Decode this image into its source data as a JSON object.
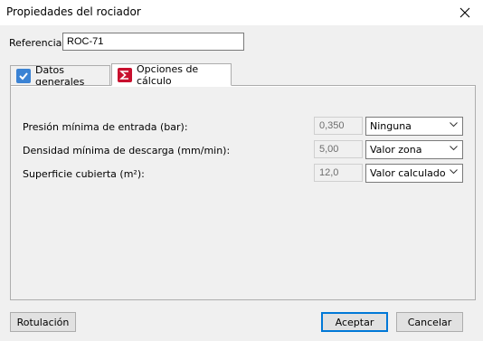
{
  "window": {
    "title": "Propiedades del rociador"
  },
  "reference": {
    "label": "Referencia:",
    "value": "ROC-71"
  },
  "tabs": [
    {
      "label": "Datos generales",
      "icon": "checkbox-icon",
      "color": "#3b83d4"
    },
    {
      "label": "Opciones de cálculo",
      "icon": "sigma-icon",
      "color": "#c8102e"
    }
  ],
  "rows": [
    {
      "label": "Presión mínima de entrada (bar):",
      "value": "0,350",
      "option": "Ninguna"
    },
    {
      "label": "Densidad mínima de descarga (mm/min):",
      "value": "5,00",
      "option": "Valor zona"
    },
    {
      "label": "Superficie cubierta (m²):",
      "value": "12,0",
      "option": "Valor calculado"
    }
  ],
  "buttons": {
    "rotulacion": "Rotulación",
    "accept": "Aceptar",
    "cancel": "Cancelar"
  },
  "colors": {
    "accent": "#0078d7"
  }
}
